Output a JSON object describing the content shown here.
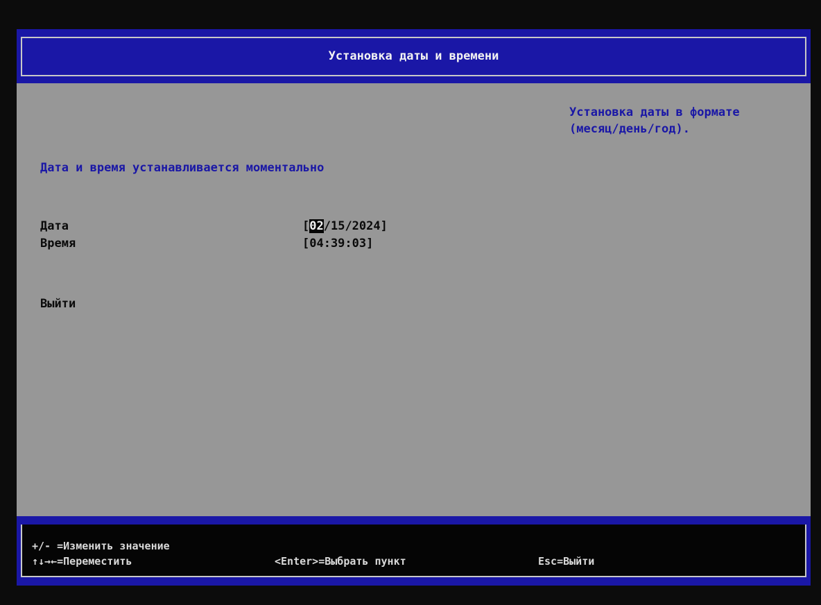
{
  "header": {
    "title": "Установка даты и времени"
  },
  "help": {
    "text": "Установка даты в формате\n(месяц/день/год)."
  },
  "main": {
    "notice": "Дата и время устанавливается моментально",
    "date": {
      "label": "Дата",
      "open_bracket": "[",
      "month": "02",
      "rest": "/15/2024]"
    },
    "time": {
      "label": "Время",
      "value": "[04:39:03]"
    },
    "exit_label": "Выйти"
  },
  "footer": {
    "change_value": "+/- =Изменить значение",
    "move": "↑↓→←=Переместить",
    "select": "<Enter>=Выбрать пункт",
    "exit": "Esc=Выйти"
  },
  "colors": {
    "title_bar": "#1a17a6",
    "content_bg": "#979797",
    "footer_bg": "#050505",
    "accent_text": "#1a17a6"
  }
}
